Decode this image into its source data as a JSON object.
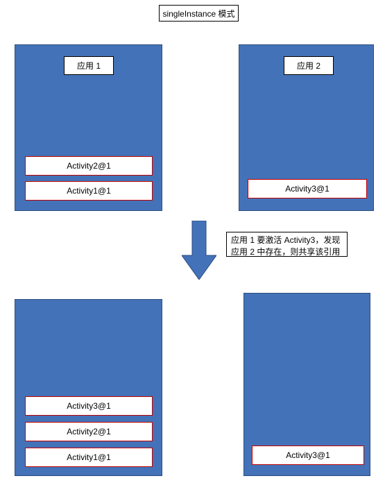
{
  "title": "singleInstance 模式",
  "top": {
    "left": {
      "label": "应用 1",
      "activities": [
        "Activity2@1",
        "Activity1@1"
      ]
    },
    "right": {
      "label": "应用 2",
      "activities": [
        "Activity3@1"
      ]
    }
  },
  "note": "应用 1 要激活 Activity3，发现应用 2 中存在，则共享该引用",
  "bottom": {
    "left": {
      "activities": [
        "Activity3@1",
        "Activity2@1",
        "Activity1@1"
      ]
    },
    "right": {
      "activities": [
        "Activity3@1"
      ]
    }
  },
  "chart_data": {
    "type": "diagram",
    "title": "singleInstance 模式",
    "annotations": [
      "应用 1 要激活 Activity3，发现应用 2 中存在，则共享该引用"
    ],
    "before": {
      "app1": {
        "label": "应用 1",
        "stack": [
          "Activity2@1",
          "Activity1@1"
        ]
      },
      "app2": {
        "label": "应用 2",
        "stack": [
          "Activity3@1"
        ]
      }
    },
    "after": {
      "app1": {
        "stack": [
          "Activity3@1",
          "Activity2@1",
          "Activity1@1"
        ]
      },
      "app2": {
        "stack": [
          "Activity3@1"
        ]
      }
    }
  }
}
